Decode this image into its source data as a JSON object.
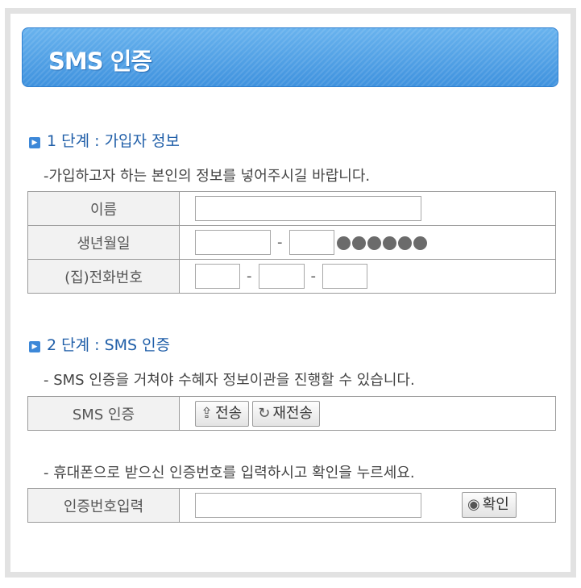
{
  "header": {
    "title": "SMS 인증"
  },
  "step1": {
    "title": "1 단계 : 가입자 정보",
    "description": "-가입하고자 하는 본인의 정보를 넣어주시길 바랍니다.",
    "rows": {
      "name_label": "이름",
      "birth_label": "생년월일",
      "phone_label": "(집)전화번호"
    },
    "separator": "-"
  },
  "step2": {
    "title": "2 단계 : SMS 인증",
    "description": "- SMS 인증을 거쳐야 수혜자 정보이관을 진행할 수 있습니다.",
    "sms_label": "SMS 인증",
    "send_button": "전송",
    "resend_button": "재전송",
    "code_description": "- 휴대폰으로 받으신 인증번호를 입력하시고 확인을 누르세요.",
    "code_label": "인증번호입력",
    "confirm_button": "확인"
  }
}
